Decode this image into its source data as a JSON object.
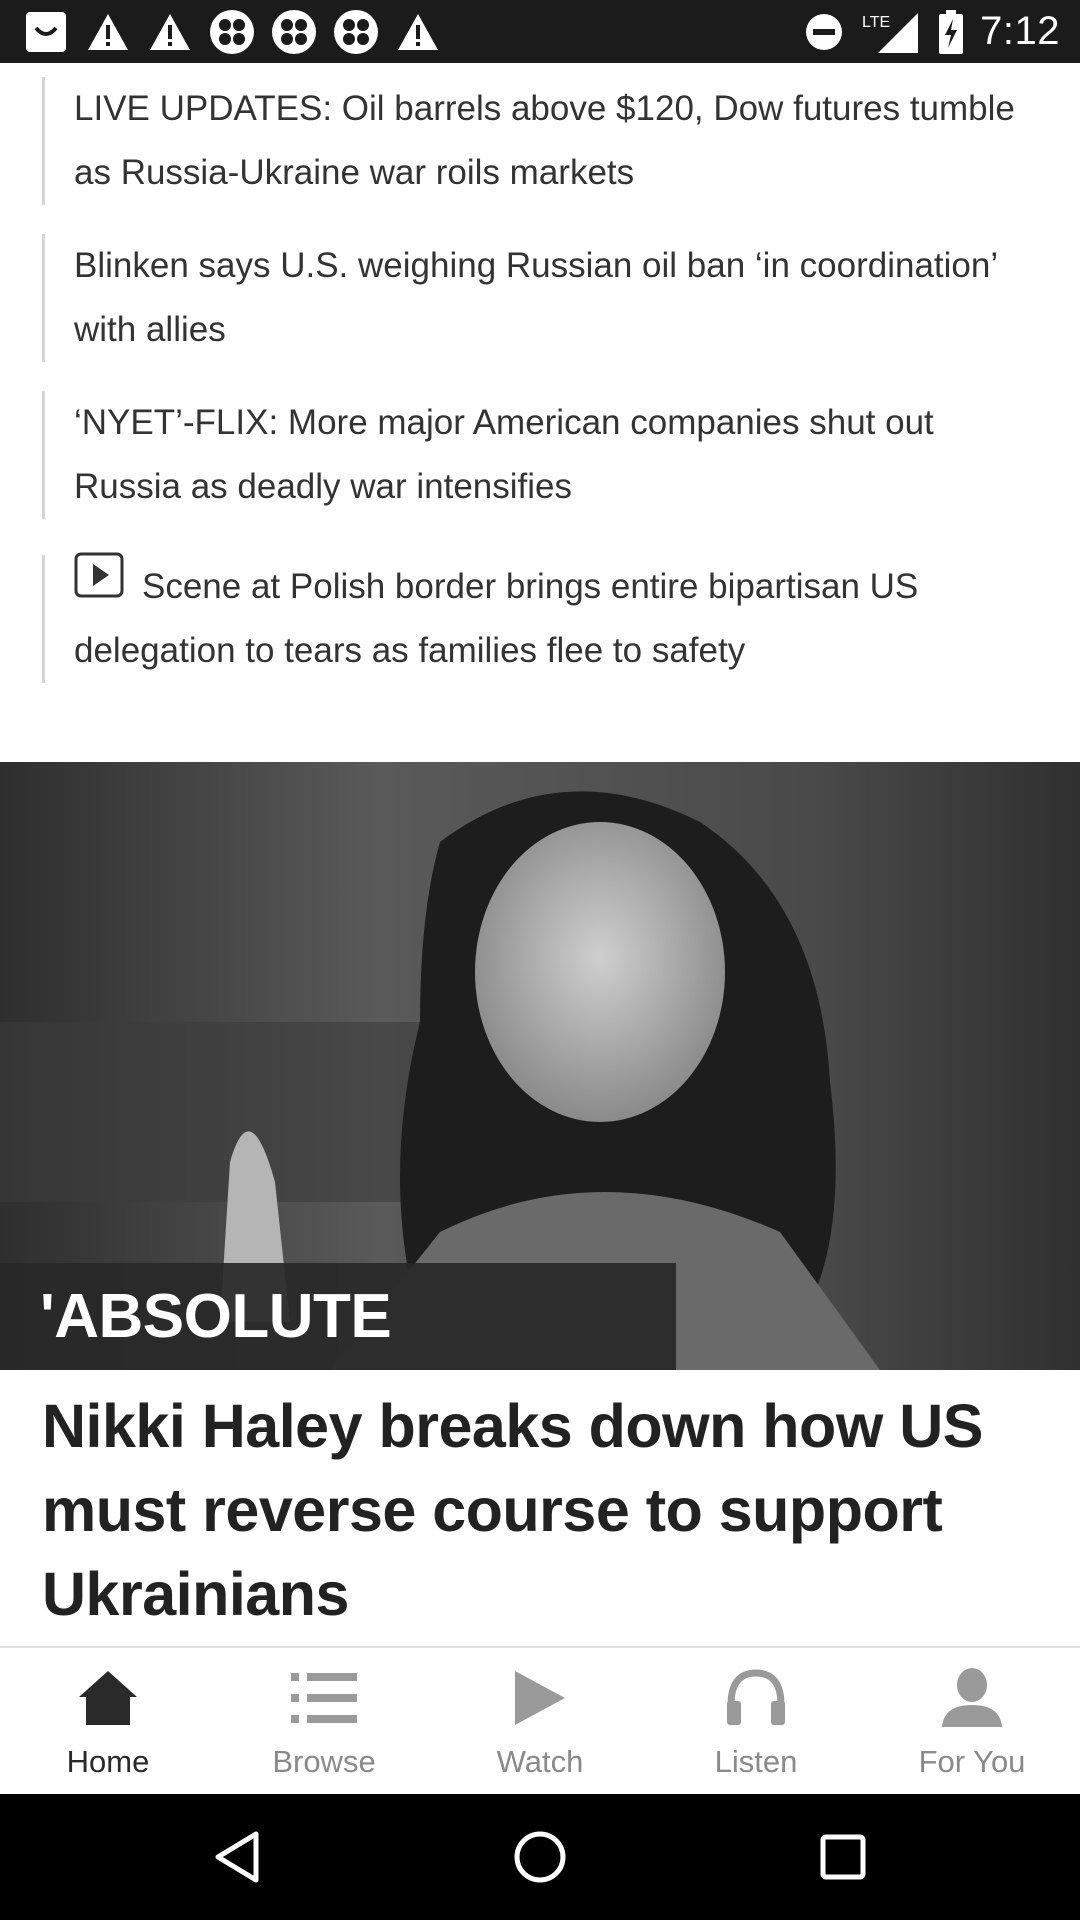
{
  "status_bar": {
    "time": "7:12",
    "network": "LTE",
    "left_icons": [
      "app-icon",
      "alert-icon",
      "alert-icon",
      "clover-icon",
      "clover-icon",
      "clover-icon",
      "alert-icon"
    ],
    "right_icons": [
      "do-not-disturb-icon",
      "lte-signal-icon",
      "battery-charging-icon"
    ]
  },
  "related_links": [
    {
      "text": "LIVE UPDATES: Oil barrels above $120, Dow futures tumble as Russia-Ukraine war roils markets",
      "video": false
    },
    {
      "text": "Blinken says U.S. weighing Russian oil ban ‘in coordination’ with allies",
      "video": false
    },
    {
      "text": "‘NYET’-FLIX: More major American companies shut out Russia as deadly war intensifies",
      "video": false
    },
    {
      "text": "Scene at Polish border brings entire bipartisan US delegation to tears as families flee to safety",
      "video": true
    }
  ],
  "hero": {
    "kicker": "'ABSOLUTE LUNACY'",
    "headline": "Nikki Haley breaks down how US must reverse course to support Ukrainians"
  },
  "bottom_nav": {
    "items": [
      {
        "label": "Home",
        "icon": "home-icon",
        "active": true
      },
      {
        "label": "Browse",
        "icon": "list-icon",
        "active": false
      },
      {
        "label": "Watch",
        "icon": "play-icon",
        "active": false
      },
      {
        "label": "Listen",
        "icon": "headphones-icon",
        "active": false
      },
      {
        "label": "For You",
        "icon": "person-icon",
        "active": false
      }
    ]
  },
  "system_nav": [
    "back-icon",
    "home-circle-icon",
    "recents-icon"
  ],
  "colors": {
    "status_bar": "#1b1b1b",
    "text": "#333333",
    "nav_active": "#2a2a2a",
    "nav_inactive": "#8a8a8a",
    "system_nav": "#000000"
  }
}
